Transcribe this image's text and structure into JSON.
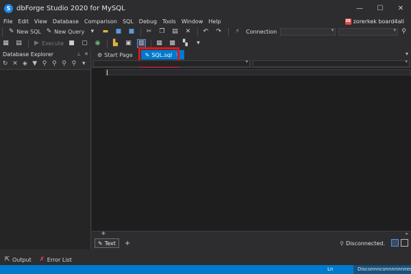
{
  "window": {
    "title": "dbForge Studio 2020 for MySQL",
    "logo": "S"
  },
  "menu": [
    "File",
    "Edit",
    "View",
    "Database",
    "Comparison",
    "SQL",
    "Debug",
    "Tools",
    "Window",
    "Help"
  ],
  "user": {
    "initials": "ZB",
    "name": "zorerkek board4all"
  },
  "toolbar1": {
    "new_sql": "New SQL",
    "new_query": "New Query",
    "connection_label": "Connection"
  },
  "toolbar2": {
    "execute": "Execute"
  },
  "explorer": {
    "title": "Database Explorer"
  },
  "tabs": {
    "start_page": "Start Page",
    "sql_file": "SQL.sql"
  },
  "bottom": {
    "text_tab": "Text",
    "status": "Disconnected."
  },
  "output_bar": {
    "output": "Output",
    "error_list": "Error List"
  },
  "statusbar": {
    "ln": "Ln",
    "conn_status": "Disconnnconnnnnnnect"
  },
  "colors": {
    "accent": "#007acc",
    "highlight": "#e3151b",
    "background": "#2d2d30",
    "editor": "#1e1e1e"
  }
}
